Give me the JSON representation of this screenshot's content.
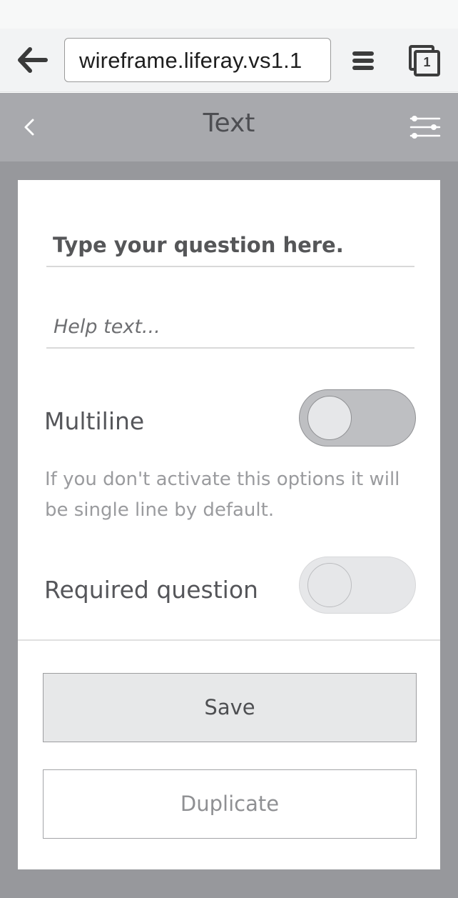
{
  "browser": {
    "url": "wireframe.liferay.vs1.1",
    "tab_count": "1",
    "icons": {
      "back": "back-arrow-icon",
      "menu": "hamburger-menu-icon",
      "tabs": "tabs-icon"
    }
  },
  "appbar": {
    "title": "Text",
    "icons": {
      "back": "chevron-left-icon",
      "settings": "sliders-icon"
    }
  },
  "form": {
    "question_placeholder": "Type your question here.",
    "help_placeholder": "Help text...",
    "multiline": {
      "label": "Multiline",
      "hint": "If you don't activate this options it will be single line by default.",
      "on": false
    },
    "required": {
      "label": "Required question",
      "on": false
    }
  },
  "actions": {
    "save_label": "Save",
    "duplicate_label": "Duplicate"
  },
  "colors": {
    "app_bar": "#a8a9ad",
    "stage": "#97989c",
    "card": "#ffffff",
    "browser_bar": "#f2f3f4"
  }
}
